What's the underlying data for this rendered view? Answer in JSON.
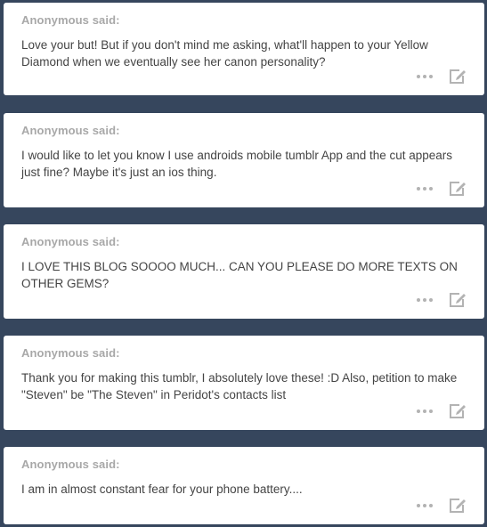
{
  "posts": [
    {
      "asker": "Anonymous said:",
      "question": "Love your but! But if you don't mind me asking, what'll happen to your Yellow Diamond when we eventually see her canon personality?"
    },
    {
      "asker": "Anonymous said:",
      "question": "I would like to let you know I use androids mobile tumblr App and the cut appears just fine? Maybe it's just an ios thing."
    },
    {
      "asker": "Anonymous said:",
      "question": "I LOVE THIS BLOG SOOOO MUCH... CAN YOU PLEASE DO MORE TEXTS ON OTHER GEMS?"
    },
    {
      "asker": "Anonymous said:",
      "question": "Thank you for making this tumblr, I absolutely love these! :D Also, petition to make \"Steven\" be \"The Steven\" in Peridot's contacts list"
    },
    {
      "asker": "Anonymous said:",
      "question": "I am in almost constant fear for your phone battery...."
    }
  ],
  "icons": {
    "more": "more-dots-icon",
    "edit": "edit-pencil-icon"
  },
  "colors": {
    "background": "#36465d",
    "card": "#ffffff",
    "asker": "#a8a8a8",
    "text": "#444444",
    "icon": "#b3b3b3"
  }
}
